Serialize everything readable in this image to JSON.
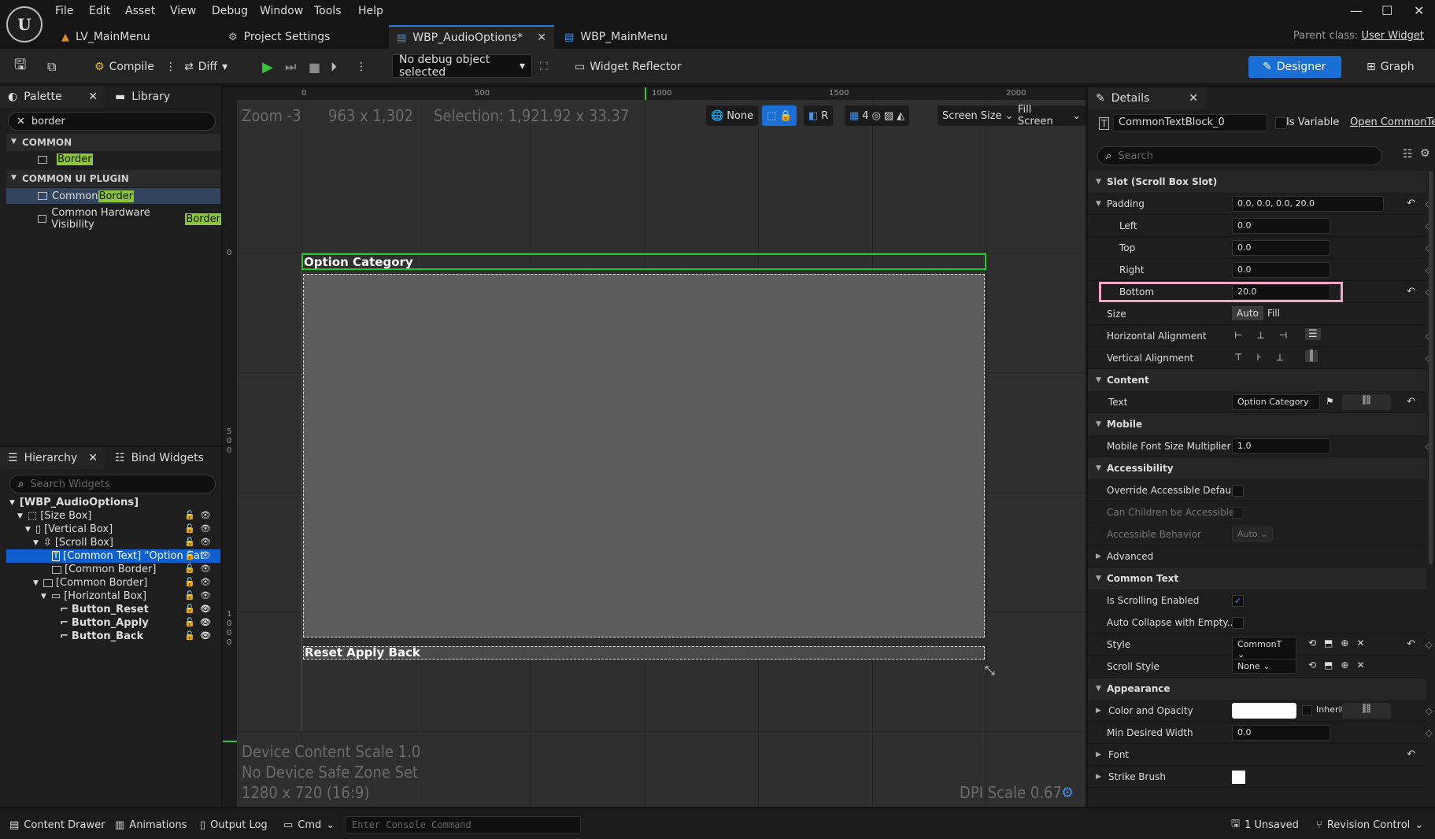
{
  "menu": [
    "File",
    "Edit",
    "Asset",
    "View",
    "Debug",
    "Window",
    "Tools",
    "Help"
  ],
  "tabs": [
    {
      "label": "LV_MainMenu"
    },
    {
      "label": "Project Settings"
    },
    {
      "label": "WBP_AudioOptions*"
    },
    {
      "label": "WBP_MainMenu"
    }
  ],
  "parent_class": {
    "label": "Parent class:",
    "value": "User Widget"
  },
  "toolbar": {
    "compile": "Compile",
    "diff": "Diff",
    "debug_object": "No debug object selected",
    "widget_reflector": "Widget Reflector",
    "designer": "Designer",
    "graph": "Graph"
  },
  "palette": {
    "tab": "Palette",
    "library_tab": "Library",
    "search_value": "border",
    "sections": [
      {
        "title": "COMMON",
        "items": [
          {
            "prefix": "",
            "match": "Border"
          }
        ]
      },
      {
        "title": "COMMON UI PLUGIN",
        "items": [
          {
            "prefix": "Common ",
            "match": "Border"
          },
          {
            "prefix": "Common Hardware Visibility ",
            "match": "Border"
          }
        ]
      }
    ]
  },
  "hierarchy": {
    "tab": "Hierarchy",
    "bind_tab": "Bind Widgets",
    "search_placeholder": "Search Widgets",
    "root": "[WBP_AudioOptions]",
    "rows": [
      {
        "label": "[Size Box]"
      },
      {
        "label": "[Vertical Box]"
      },
      {
        "label": "[Scroll Box]"
      },
      {
        "label": "[Common Text] \"Option Cat"
      },
      {
        "label": "[Common Border]"
      },
      {
        "label": "[Common Border]"
      },
      {
        "label": "[Horizontal Box]"
      },
      {
        "label": "Button_Reset"
      },
      {
        "label": "Button_Apply"
      },
      {
        "label": "Button_Back"
      }
    ]
  },
  "viewport": {
    "zoom": "Zoom -3",
    "size": "963 x 1,302",
    "selection": "Selection: 1,921.92 x 33.37",
    "none_btn": "None",
    "r_btn": "R",
    "grid_num": "4",
    "screen_size": "Screen Size",
    "fill_screen": "Fill Screen",
    "ruler_top": [
      "0",
      "500",
      "1000",
      "1500",
      "2000"
    ],
    "ruler_left": [
      "0",
      "5",
      "0",
      "0",
      "1",
      "0",
      "0",
      "0"
    ],
    "option_category": "Option Category",
    "buttons_text": "Reset Apply Back",
    "device_scale": "Device Content Scale 1.0",
    "safe_zone": "No Device Safe Zone Set",
    "resolution": "1280 x 720 (16:9)",
    "dpi": "DPI Scale 0.67"
  },
  "details": {
    "tab": "Details",
    "widget_name": "CommonTextBlock_0",
    "is_variable": "Is Variable",
    "open_link": "Open CommonTex",
    "search_placeholder": "Search",
    "slot_section": "Slot (Scroll Box Slot)",
    "padding": {
      "label": "Padding",
      "value": "0.0, 0.0, 0.0, 20.0"
    },
    "left": {
      "label": "Left",
      "value": "0.0"
    },
    "top": {
      "label": "Top",
      "value": "0.0"
    },
    "right": {
      "label": "Right",
      "value": "0.0"
    },
    "bottom": {
      "label": "Bottom",
      "value": "20.0"
    },
    "size": {
      "label": "Size",
      "auto": "Auto",
      "fill": "Fill"
    },
    "h_align": "Horizontal Alignment",
    "v_align": "Vertical Alignment",
    "content_section": "Content",
    "text": {
      "label": "Text",
      "value": "Option Category"
    },
    "mobile_section": "Mobile",
    "mobile_font": {
      "label": "Mobile Font Size Multiplier",
      "value": "1.0"
    },
    "accessibility_section": "Accessibility",
    "override_access": "Override Accessible Defaults",
    "can_children": "Can Children be Accessible",
    "access_behavior": {
      "label": "Accessible Behavior",
      "value": "Auto"
    },
    "advanced": "Advanced",
    "common_text_section": "Common Text",
    "scrolling": "Is Scrolling Enabled",
    "auto_collapse": "Auto Collapse with Empty...",
    "style": {
      "label": "Style",
      "value": "CommonT"
    },
    "scroll_style": {
      "label": "Scroll Style",
      "value": "None"
    },
    "appearance_section": "Appearance",
    "color_opacity": {
      "label": "Color and Opacity",
      "inherit": "Inherit"
    },
    "min_width": {
      "label": "Min Desired Width",
      "value": "0.0"
    },
    "font": "Font",
    "strike_brush": "Strike Brush"
  },
  "status": {
    "content_drawer": "Content Drawer",
    "animations": "Animations",
    "output_log": "Output Log",
    "cmd": "Cmd",
    "console_placeholder": "Enter Console Command",
    "unsaved": "1 Unsaved",
    "revision": "Revision Control"
  },
  "colors": {
    "accent": "#1a6fd6",
    "highlight": "#8cc43a",
    "selection_outline": "#22cc22",
    "bottom_box": "#f2a7c4"
  }
}
